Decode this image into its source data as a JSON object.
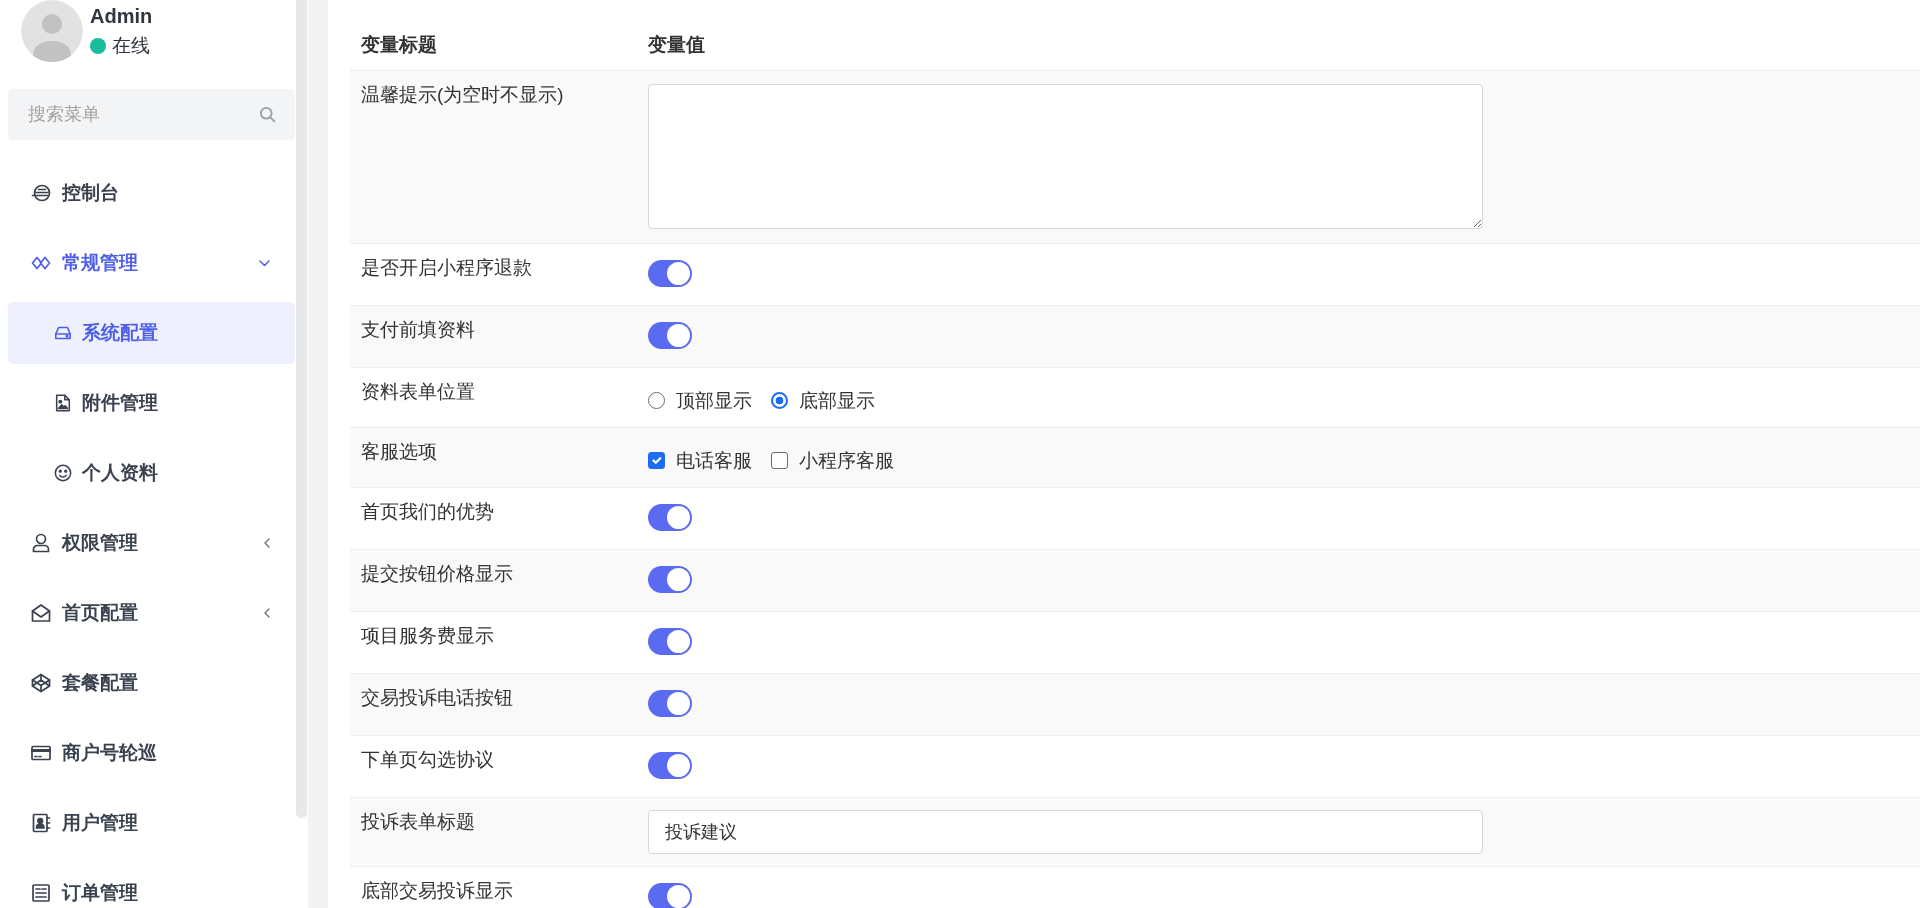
{
  "sidebar": {
    "user": {
      "name": "Admin",
      "status": "在线",
      "online": true
    },
    "search": {
      "placeholder": "搜索菜单"
    },
    "menu": [
      {
        "label": "控制台",
        "kind": "link",
        "selected": false
      },
      {
        "label": "常规管理",
        "kind": "group",
        "selected": false,
        "expanded": true,
        "children": [
          {
            "label": "系统配置",
            "kind": "link",
            "selected": true
          },
          {
            "label": "附件管理",
            "kind": "link",
            "selected": false
          },
          {
            "label": "个人资料",
            "kind": "link",
            "selected": false
          }
        ]
      },
      {
        "label": "权限管理",
        "kind": "group",
        "selected": false,
        "expanded": false
      },
      {
        "label": "首页配置",
        "kind": "group",
        "selected": false,
        "expanded": false
      },
      {
        "label": "套餐配置",
        "kind": "link",
        "selected": false
      },
      {
        "label": "商户号轮巡",
        "kind": "link",
        "selected": false
      },
      {
        "label": "用户管理",
        "kind": "link",
        "selected": false
      },
      {
        "label": "订单管理",
        "kind": "link",
        "selected": false
      }
    ]
  },
  "table": {
    "columns": [
      "变量标题",
      "变量值"
    ],
    "rows": [
      {
        "label": "温馨提示(为空时不显示)",
        "kind": "textarea"
      },
      {
        "label": "是否开启小程序退款",
        "kind": "switch",
        "on": true
      },
      {
        "label": "支付前填资料",
        "kind": "switch",
        "on": true
      },
      {
        "label": "资料表单位置",
        "kind": "radio",
        "options": [
          {
            "label": "顶部显示",
            "selected": false
          },
          {
            "label": "底部显示",
            "selected": true
          }
        ]
      },
      {
        "label": "客服选项",
        "kind": "checkbox",
        "options": [
          {
            "label": "电话客服",
            "checked": true
          },
          {
            "label": "小程序客服",
            "checked": false
          }
        ]
      },
      {
        "label": "首页我们的优势",
        "kind": "switch",
        "on": true
      },
      {
        "label": "提交按钮价格显示",
        "kind": "switch",
        "on": true
      },
      {
        "label": "项目服务费显示",
        "kind": "switch",
        "on": true
      },
      {
        "label": "交易投诉电话按钮",
        "kind": "switch",
        "on": true
      },
      {
        "label": "下单页勾选协议",
        "kind": "switch",
        "on": true
      },
      {
        "label": "投诉表单标题",
        "kind": "text",
        "value": "投诉建议"
      },
      {
        "label": "底部交易投诉显示",
        "kind": "switch",
        "on": true
      }
    ]
  }
}
